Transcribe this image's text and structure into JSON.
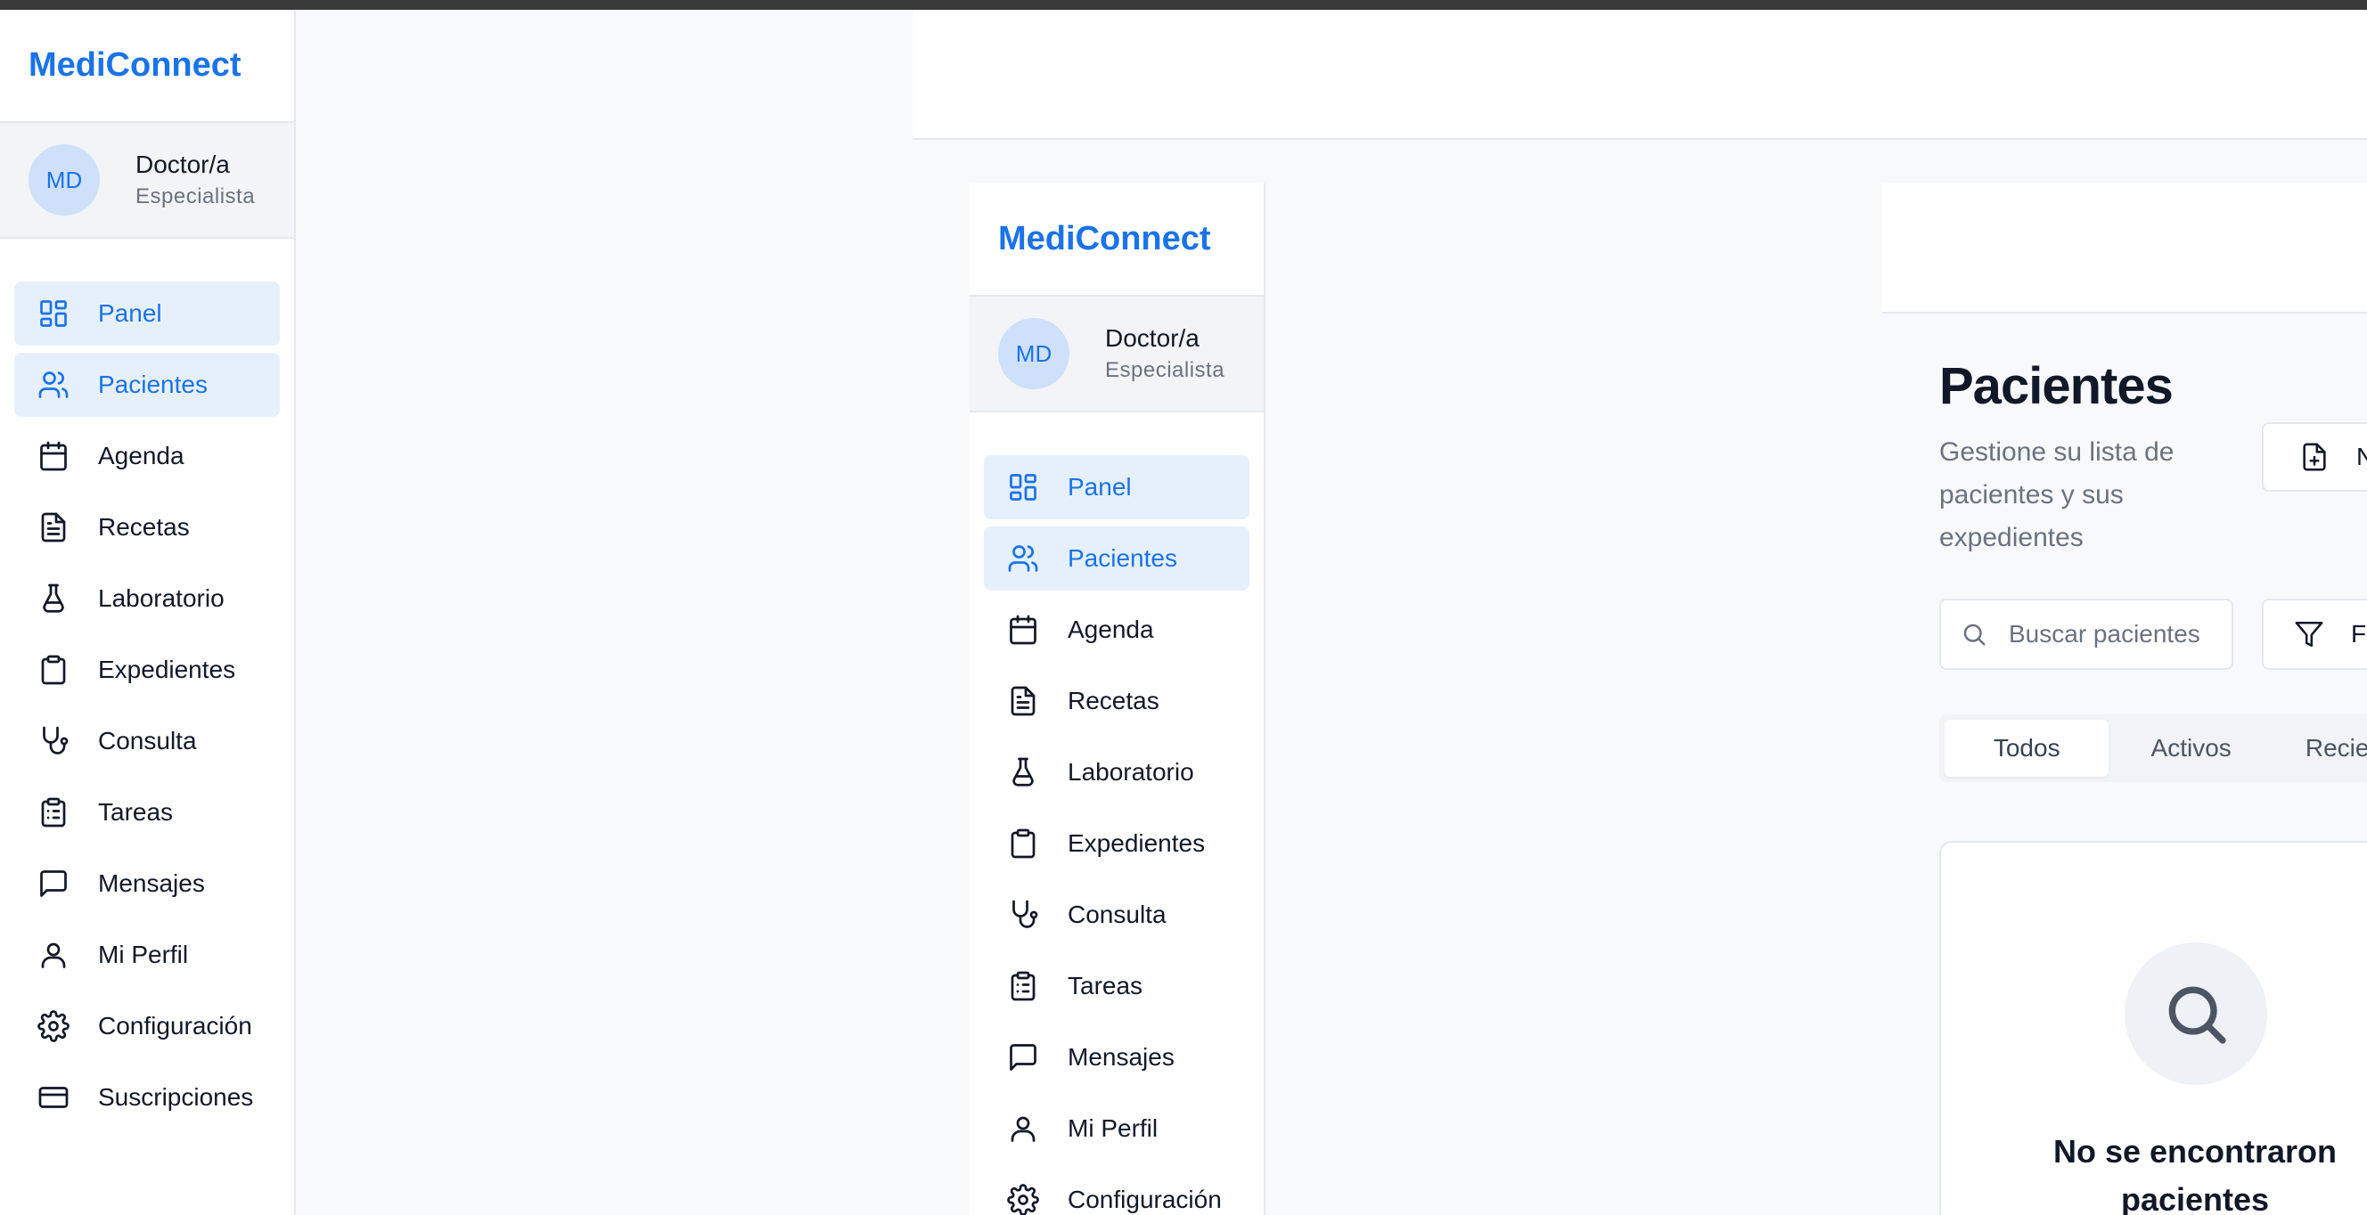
{
  "app": {
    "name": "MediConnect"
  },
  "user": {
    "initials": "MD",
    "name": "Doctor/a",
    "role": "Especialista"
  },
  "nav": [
    {
      "label": "Panel",
      "icon": "dashboard-icon",
      "active": true
    },
    {
      "label": "Pacientes",
      "icon": "users-icon",
      "active": true
    },
    {
      "label": "Agenda",
      "icon": "calendar-icon",
      "active": false
    },
    {
      "label": "Recetas",
      "icon": "file-text-icon",
      "active": false
    },
    {
      "label": "Laboratorio",
      "icon": "flask-icon",
      "active": false
    },
    {
      "label": "Expedientes",
      "icon": "clipboard-icon",
      "active": false
    },
    {
      "label": "Consulta",
      "icon": "stethoscope-icon",
      "active": false
    },
    {
      "label": "Tareas",
      "icon": "clipboard-list-icon",
      "active": false
    },
    {
      "label": "Mensajes",
      "icon": "message-icon",
      "active": false
    },
    {
      "label": "Mi Perfil",
      "icon": "user-icon",
      "active": false
    },
    {
      "label": "Configuración",
      "icon": "gear-icon",
      "active": false
    },
    {
      "label": "Suscripciones",
      "icon": "credit-card-icon",
      "active": false
    }
  ],
  "page": {
    "title": "Pacientes",
    "subtitle": "Gestione su lista de pacientes y sus expedientes",
    "new_button": "N",
    "filter_button": "Fi"
  },
  "search": {
    "placeholder": "Buscar pacientes"
  },
  "tabs": [
    {
      "label": "Todos",
      "active": true
    },
    {
      "label": "Activos",
      "active": false
    },
    {
      "label": "Recie",
      "active": false
    }
  ],
  "empty_state": {
    "title": "No se encontraron pacientes"
  },
  "colors": {
    "accent": "#1a73e8",
    "active_bg": "#e6f0fd",
    "muted": "#6b7280",
    "border": "#e5e7eb"
  }
}
